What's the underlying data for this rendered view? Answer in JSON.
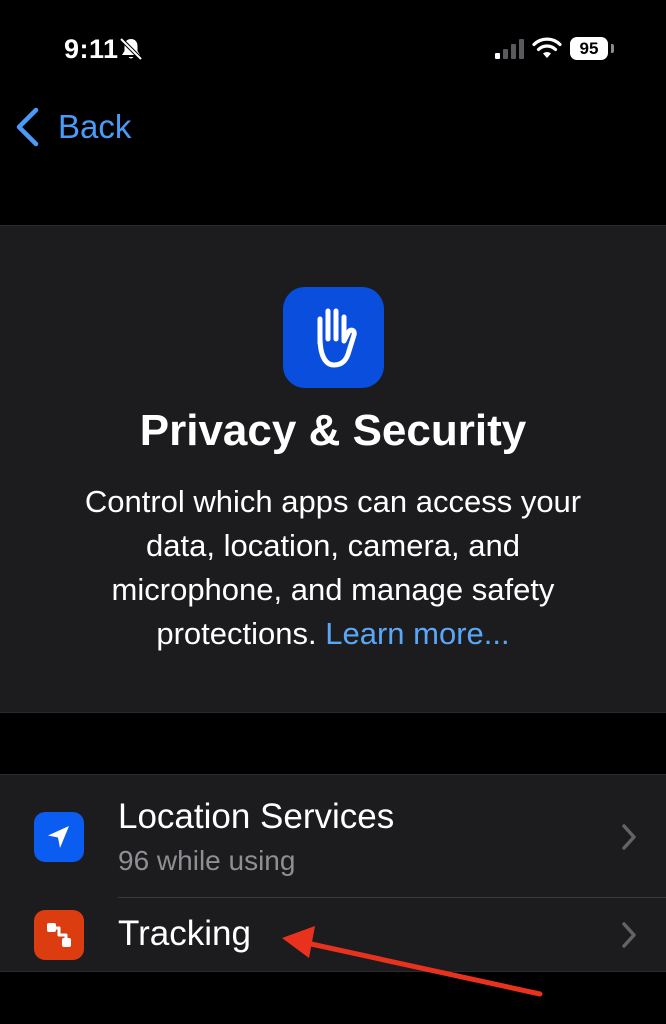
{
  "status_bar": {
    "time": "9:11",
    "battery": "95",
    "icons": [
      "bell-slash-icon",
      "cellular-signal-icon",
      "wifi-icon",
      "battery-icon"
    ]
  },
  "nav": {
    "back_label": "Back",
    "back_icon": "chevron-left-icon"
  },
  "header": {
    "icon": "raised-hand-icon",
    "title": "Privacy & Security",
    "description": "Control which apps can access your data, location, camera, and microphone, and manage safety protections.",
    "learn_more": "Learn more..."
  },
  "settings": {
    "items": [
      {
        "title": "Location Services",
        "subtitle": "96 while using",
        "icon": "location-arrow-icon"
      },
      {
        "title": "Tracking",
        "icon": "tracking-icon"
      }
    ]
  },
  "colors": {
    "background": "#000000",
    "card": "#1c1c1e",
    "accent_blue": "#4a9bf8",
    "privacy_icon_bg": "#0a4ede",
    "location_icon_bg": "#0b5cf0",
    "tracking_icon_bg": "#dc3d10",
    "annotation_arrow": "#e8321e"
  }
}
